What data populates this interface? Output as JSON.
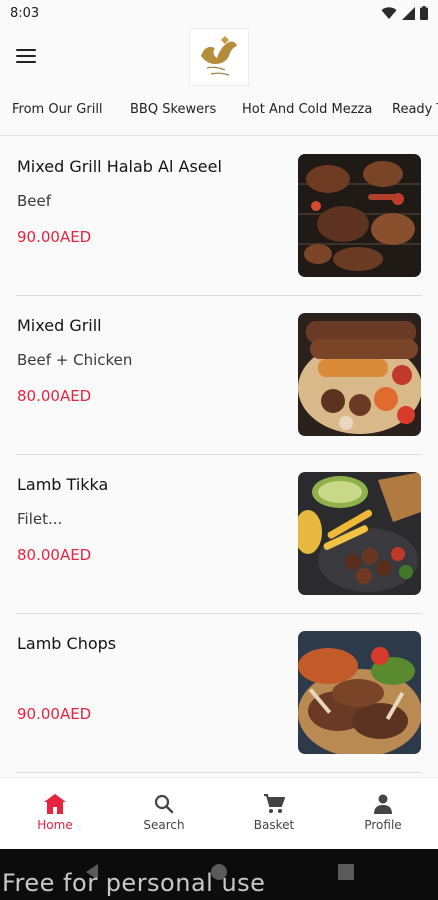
{
  "status_bar": {
    "time": "8:03",
    "icons": [
      "wifi-icon",
      "signal-icon",
      "battery-icon"
    ]
  },
  "header": {
    "menu_icon": "hamburger-menu-icon",
    "logo_icon": "restaurant-logo"
  },
  "tabs": [
    {
      "label": "From Our Grill",
      "active": true
    },
    {
      "label": "BBQ Skewers",
      "active": false
    },
    {
      "label": "Hot And Cold Mezza",
      "active": false
    },
    {
      "label": "Ready T",
      "active": false
    }
  ],
  "items": [
    {
      "name": "Mixed Grill Halab Al Aseel",
      "description": "Beef",
      "price": "90.00AED"
    },
    {
      "name": "Mixed Grill",
      "description": "Beef + Chicken",
      "price": "80.00AED"
    },
    {
      "name": "Lamb Tikka",
      "description": "Filet...",
      "price": "80.00AED"
    },
    {
      "name": "Lamb Chops",
      "description": "",
      "price": "90.00AED"
    }
  ],
  "bottom_nav": [
    {
      "label": "Home",
      "icon": "home-icon",
      "active": true
    },
    {
      "label": "Search",
      "icon": "search-icon",
      "active": false
    },
    {
      "label": "Basket",
      "icon": "cart-icon",
      "active": false
    },
    {
      "label": "Profile",
      "icon": "person-icon",
      "active": false
    }
  ],
  "watermark": "Free for personal use",
  "colors": {
    "accent": "#e8233f",
    "background": "#fafafa",
    "system_nav": "#0c0c0c"
  }
}
